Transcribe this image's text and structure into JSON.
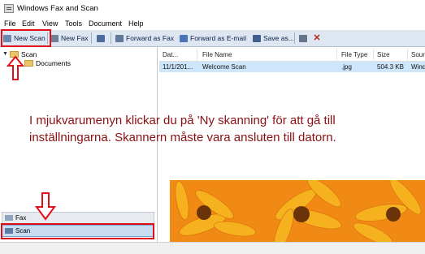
{
  "window": {
    "title": "Windows Fax and Scan"
  },
  "menu": [
    "File",
    "Edit",
    "View",
    "Tools",
    "Document",
    "Help"
  ],
  "toolbar": {
    "new_scan": "New Scan",
    "new_fax": "New Fax",
    "forward_fax": "Forward as Fax",
    "forward_email": "Forward as E-mail",
    "save_as": "Save as..."
  },
  "tree": {
    "root": "Scan",
    "child": "Documents"
  },
  "nav": {
    "fax": "Fax",
    "scan": "Scan"
  },
  "list": {
    "columns": [
      "Dat...",
      "File Name",
      "File Type",
      "Size",
      "Sourc"
    ],
    "rows": [
      {
        "date": "11/1/201...",
        "name": "Welcome Scan",
        "type": ".jpg",
        "size": "504.3 KB",
        "source": "Wind"
      }
    ]
  },
  "caption": "I mjukvarumenyn klickar du på 'Ny skanning' för att gå till inställningarna. Skannern måste vara ansluten till datorn.",
  "colors": {
    "accent_red": "#e0101a",
    "caption": "#8b0f12",
    "toolbar": "#dde6f1",
    "selection": "#cde6fb"
  }
}
